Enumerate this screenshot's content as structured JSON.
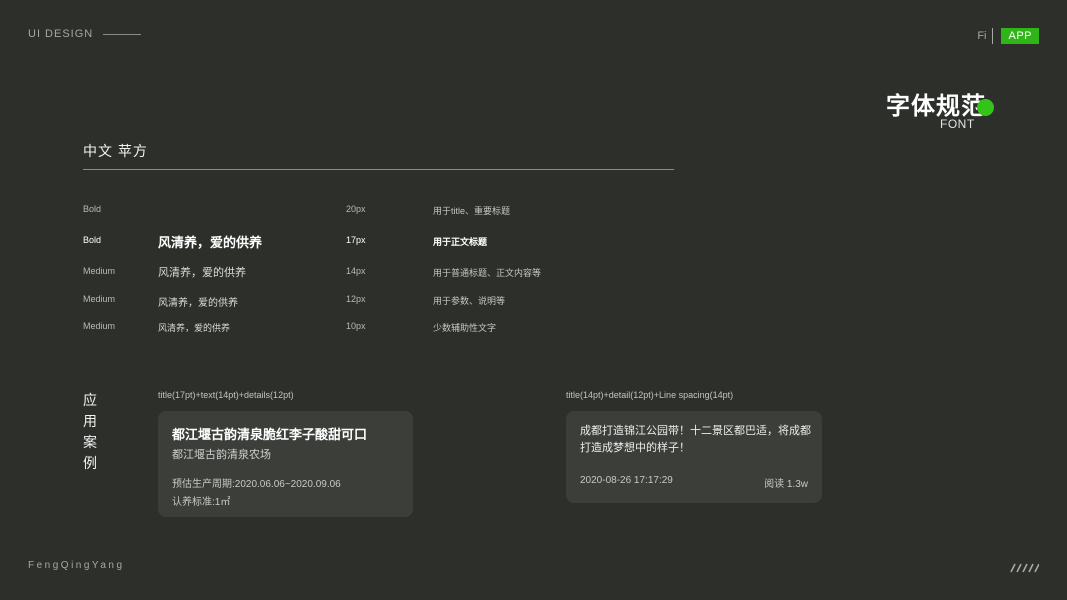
{
  "header": {
    "brand": "UI DESIGN",
    "fi_label": "Fi",
    "app_badge": "APP",
    "title": "字体规范",
    "subtitle": "FONT"
  },
  "section": {
    "title": "中文 苹方"
  },
  "specs": [
    {
      "weight": "Bold",
      "sample": "",
      "size": "20px",
      "usage": "用于title、重要标题"
    },
    {
      "weight": "Bold",
      "sample": "风清养，爱的供养",
      "size": "17px",
      "usage": "用于正文标题"
    },
    {
      "weight": "Medium",
      "sample": "风清养，爱的供养",
      "size": "14px",
      "usage": "用于普通标题、正文内容等"
    },
    {
      "weight": "Medium",
      "sample": "风清养，爱的供养",
      "size": "12px",
      "usage": "用于参数、说明等"
    },
    {
      "weight": "Medium",
      "sample": "风清养，爱的供养",
      "size": "10px",
      "usage": "少数辅助性文字"
    }
  ],
  "application": {
    "label": "应用案例",
    "caption1": "title(17pt)+text(14pt)+details(12pt)",
    "caption2": "title(14pt)+detail(12pt)+Line spacing(14pt)",
    "card1": {
      "title": "都江堰古韵清泉脆红李子酸甜可口",
      "subtitle": "都江堰古韵清泉农场",
      "detail1": "预估生产周期:2020.06.06~2020.09.06",
      "detail2": "认养标准:1㎡"
    },
    "card2": {
      "text": "成都打造锦江公园带！十二景区都巴适，将成都打造成梦想中的样子！",
      "date": "2020-08-26   17:17:29",
      "reads": "阅读 1.3w"
    }
  },
  "footer": {
    "signature": "FengQingYang"
  },
  "colors": {
    "background": "#2c2f2a",
    "accent": "#33c419",
    "card": "#3b3e39"
  }
}
